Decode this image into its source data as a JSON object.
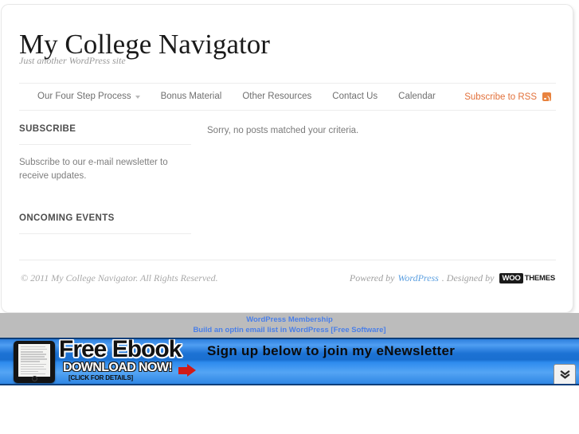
{
  "site": {
    "title": "My College Navigator",
    "tagline": "Just another WordPress site"
  },
  "nav": {
    "items": [
      {
        "label": "Our Four Step Process",
        "has_dropdown": true,
        "icon": "chevron-down-icon"
      },
      {
        "label": "Bonus Material",
        "has_dropdown": false
      },
      {
        "label": "Other Resources",
        "has_dropdown": false
      },
      {
        "label": "Contact Us",
        "has_dropdown": false
      },
      {
        "label": "Calendar",
        "has_dropdown": false
      }
    ],
    "rss": {
      "label": "Subscribe to RSS",
      "icon": "rss-icon",
      "color": "#e2703a"
    }
  },
  "sidebar": {
    "widgets": [
      {
        "title": "SUBSCRIBE",
        "body": "Subscribe to our e-mail newsletter to receive updates."
      },
      {
        "title": "ONCOMING EVENTS",
        "body": ""
      }
    ]
  },
  "main": {
    "message": "Sorry, no posts matched your criteria."
  },
  "footer": {
    "copyright": "© 2011 My College Navigator. All Rights Reserved.",
    "powered_by_prefix": "Powered by ",
    "powered_by_link": "WordPress",
    "designed_by": ". Designed by ",
    "woo_mark": "WOO",
    "woo_word": "THEMES"
  },
  "ad_strip": {
    "links": [
      "WordPress Membership",
      "Build an optin email list in WordPress [Free Software]"
    ],
    "link_color": "#4a7fe8",
    "background": "#bcbcbc"
  },
  "banner": {
    "ebook_title": "Free Ebook",
    "ebook_cta": "DOWNLOAD NOW!",
    "ebook_note": "[CLICK FOR DETAILS]",
    "arrow_icon": "right-arrow-icon",
    "headline": "Sign up below to join my eNewsletter",
    "collapse_icon": "double-chevron-down-icon",
    "background_color": "#2d7fdd"
  }
}
